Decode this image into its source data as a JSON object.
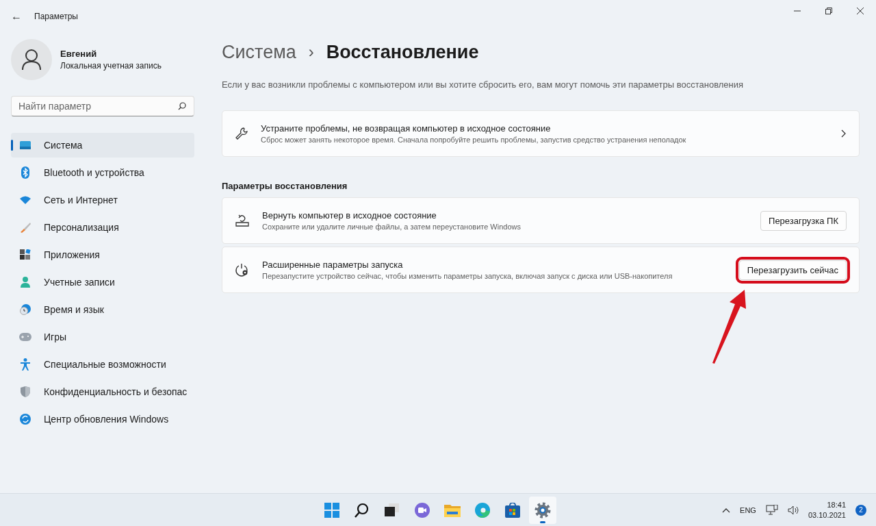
{
  "window": {
    "back": "←",
    "title": "Параметры"
  },
  "profile": {
    "name": "Евгений",
    "account": "Локальная учетная запись"
  },
  "search": {
    "placeholder": "Найти параметр"
  },
  "sidebar": {
    "items": [
      {
        "label": "Система",
        "kind": "system",
        "selected": true
      },
      {
        "label": "Bluetooth и устройства",
        "kind": "bluetooth",
        "selected": false
      },
      {
        "label": "Сеть и Интернет",
        "kind": "network",
        "selected": false
      },
      {
        "label": "Персонализация",
        "kind": "brush",
        "selected": false
      },
      {
        "label": "Приложения",
        "kind": "apps",
        "selected": false
      },
      {
        "label": "Учетные записи",
        "kind": "person",
        "selected": false
      },
      {
        "label": "Время и язык",
        "kind": "clock",
        "selected": false
      },
      {
        "label": "Игры",
        "kind": "gamepad",
        "selected": false
      },
      {
        "label": "Специальные возможности",
        "kind": "accessibility",
        "selected": false
      },
      {
        "label": "Конфиденциальность и безопас",
        "kind": "shield",
        "selected": false
      },
      {
        "label": "Центр обновления Windows",
        "kind": "update",
        "selected": false
      }
    ]
  },
  "breadcrumb": {
    "parent": "Система",
    "separator": "›",
    "current": "Восстановление"
  },
  "description": "Если у вас возникли проблемы с компьютером или вы хотите сбросить его, вам могут помочь эти параметры восстановления",
  "top_card": {
    "kind": "wrench",
    "title": "Устраните проблемы, не возвращая компьютер в исходное состояние",
    "subtitle": "Сброс может занять некоторое время. Сначала попробуйте решить проблемы, запустив средство устранения неполадок"
  },
  "section_title": "Параметры восстановления",
  "options": [
    {
      "kind": "reset",
      "title": "Вернуть компьютер в исходное состояние",
      "subtitle": "Сохраните или удалите личные файлы, а затем переустановите Windows",
      "button": "Перезагрузка ПК",
      "highlighted": false
    },
    {
      "kind": "startup",
      "title": "Расширенные параметры запуска",
      "subtitle": "Перезапустите устройство сейчас, чтобы изменить параметры запуска, включая запуск с диска или USB-накопителя",
      "button": "Перезагрузить сейчас",
      "highlighted": true
    }
  ],
  "taskbar": {
    "apps": [
      {
        "kind": "start",
        "selected": false
      },
      {
        "kind": "search",
        "selected": false
      },
      {
        "kind": "taskview",
        "selected": false
      },
      {
        "kind": "chat",
        "selected": false
      },
      {
        "kind": "folder",
        "selected": false
      },
      {
        "kind": "edge",
        "selected": false
      },
      {
        "kind": "store",
        "selected": false
      },
      {
        "kind": "settings",
        "selected": true
      }
    ],
    "language": "ENG",
    "time": "18:41",
    "date": "03.10.2021",
    "notifications": "2"
  }
}
